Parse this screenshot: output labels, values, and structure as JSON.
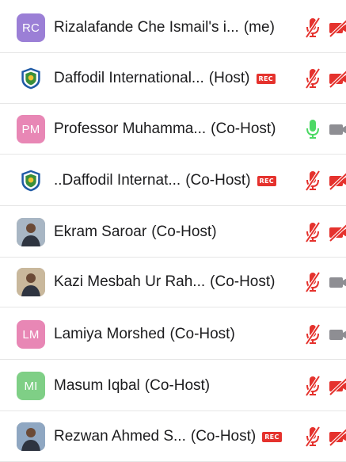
{
  "participants": [
    {
      "name": "Rizalafande Che Ismail's i...",
      "role": "(me)",
      "avatar_type": "initials",
      "initials": "RC",
      "avatar_color": "#9b7fd6",
      "rec": false,
      "mic": "muted",
      "cam": "off"
    },
    {
      "name": "Daffodil International...",
      "role": "(Host)",
      "avatar_type": "logo",
      "rec": true,
      "mic": "muted",
      "cam": "off"
    },
    {
      "name": "Professor Muhamma...",
      "role": "(Co-Host)",
      "avatar_type": "initials",
      "initials": "PM",
      "avatar_color": "#e887b5",
      "rec": false,
      "mic": "active",
      "cam": "on-gray"
    },
    {
      "name": "..Daffodil Internat...",
      "role": "(Co-Host)",
      "avatar_type": "logo",
      "rec": true,
      "mic": "muted",
      "cam": "off"
    },
    {
      "name": "Ekram Saroar",
      "role": "(Co-Host)",
      "avatar_type": "photo",
      "rec": false,
      "mic": "muted",
      "cam": "off"
    },
    {
      "name": "Kazi Mesbah Ur Rah...",
      "role": "(Co-Host)",
      "avatar_type": "photo",
      "rec": false,
      "mic": "muted",
      "cam": "on-gray"
    },
    {
      "name": "Lamiya Morshed",
      "role": "(Co-Host)",
      "avatar_type": "initials",
      "initials": "LM",
      "avatar_color": "#e887b5",
      "rec": false,
      "mic": "muted",
      "cam": "on-gray"
    },
    {
      "name": "Masum Iqbal",
      "role": "(Co-Host)",
      "avatar_type": "initials",
      "initials": "MI",
      "avatar_color": "#7fcf86",
      "rec": false,
      "mic": "muted",
      "cam": "off"
    },
    {
      "name": "Rezwan Ahmed S...",
      "role": "(Co-Host)",
      "avatar_type": "photo",
      "rec": true,
      "mic": "muted",
      "cam": "off"
    }
  ],
  "rec_label": "REC",
  "colors": {
    "muted_red": "#e5322d",
    "active_green": "#4cd964",
    "camera_gray": "#8e8e93"
  }
}
